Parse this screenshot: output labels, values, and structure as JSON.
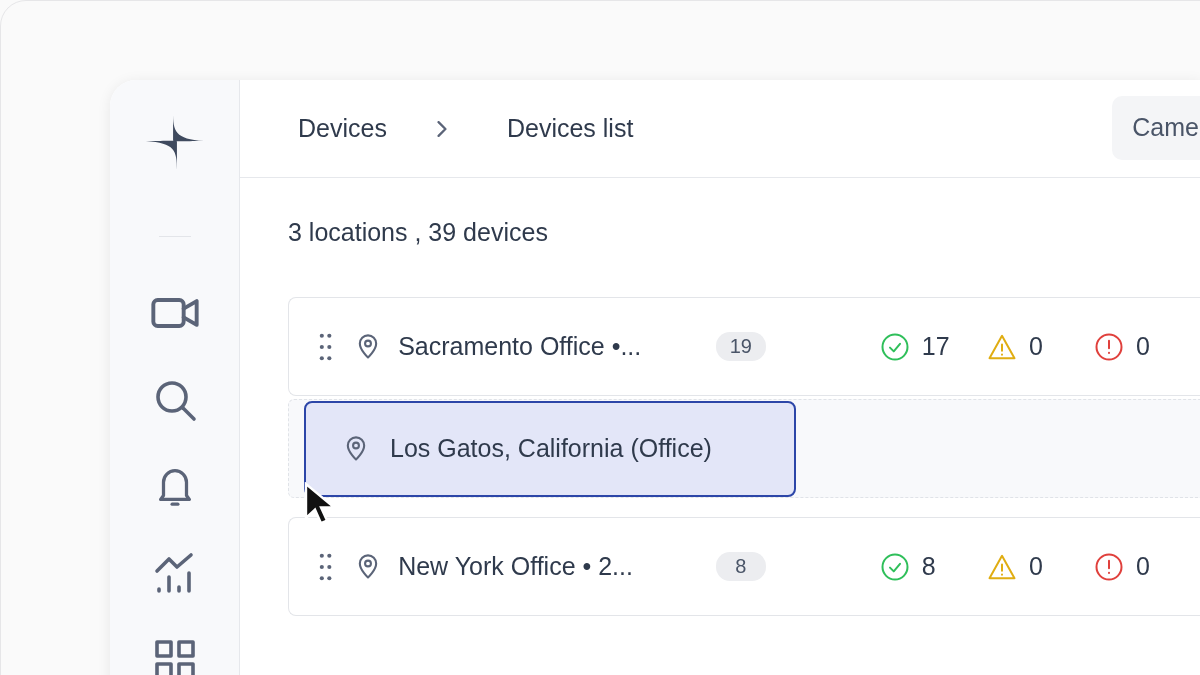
{
  "breadcrumb": [
    {
      "label": "Devices"
    },
    {
      "label": "Devices list"
    }
  ],
  "header_button": {
    "label": "Came"
  },
  "summary": "3 locations , 39 devices",
  "locations": [
    {
      "kind": "location",
      "name": "Sacramento Office •...",
      "count": "19",
      "ok": "17",
      "warning": "0",
      "error": "0"
    },
    {
      "kind": "placeholder",
      "name": "Los Gatos, California (Office)"
    },
    {
      "kind": "location",
      "name": "New York Office •  2...",
      "count": "8",
      "ok": "8",
      "warning": "0",
      "error": "0"
    }
  ]
}
